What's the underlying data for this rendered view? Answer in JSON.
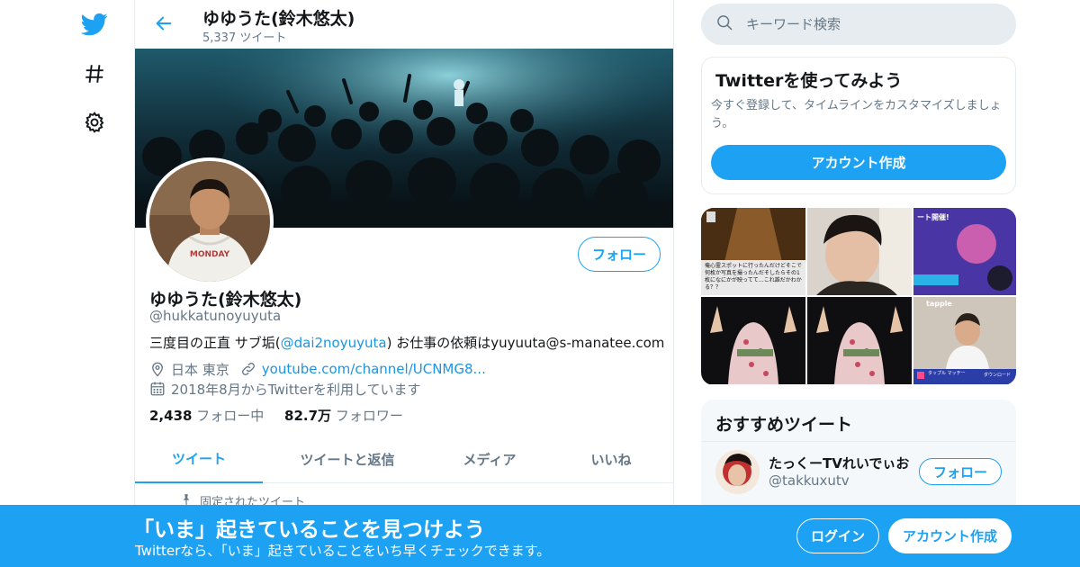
{
  "nav": {
    "icons": [
      "twitter-logo-icon",
      "hashtag-icon",
      "gear-icon"
    ]
  },
  "header": {
    "name": "ゆゆうた(鈴木悠太)",
    "tweet_count": "5,337 ツイート"
  },
  "profile": {
    "name": "ゆゆうた(鈴木悠太)",
    "handle": "@hukkatunoyuyuta",
    "bio_prefix": "三度目の正直 サブ垢(",
    "bio_link": "@dai2noyuyuta",
    "bio_suffix": ") お仕事の依頼はyuyuuta@s-manatee.com",
    "location": "日本 東京",
    "website": "youtube.com/channel/UCNMG8...",
    "joined": "2018年8月からTwitterを利用しています",
    "following_count": "2,438",
    "following_label": "フォロー中",
    "followers_count": "82.7万",
    "followers_label": "フォロワー",
    "follow_label": "フォロー",
    "avatar_shirt_text": "MONDAY"
  },
  "tabs": [
    {
      "label": "ツイート",
      "active": true
    },
    {
      "label": "ツイートと返信",
      "active": false
    },
    {
      "label": "メディア",
      "active": false
    },
    {
      "label": "いいね",
      "active": false
    }
  ],
  "pinned_label": "固定されたツイート",
  "search": {
    "placeholder": "キーワード検索"
  },
  "signup_card": {
    "title": "Twitterを使ってみよう",
    "description": "今すぐ登録して、タイムラインをカスタマイズしましょう。",
    "button": "アカウント作成"
  },
  "media_thumbs": [
    {
      "caption": "俺心霊スポットに行ったんだけどそこで何枚か写真を撮ったんだそしたらその1枚になにかが映ってて…これ誰だかわかる？？"
    },
    {
      "caption": ""
    },
    {
      "caption": "ート開催!"
    },
    {
      "caption": ""
    },
    {
      "caption": ""
    },
    {
      "caption": "tapple",
      "sub1": "タップル マッチー",
      "sub2": "ダウンロード"
    }
  ],
  "recommend": {
    "title": "おすすめツイート",
    "name": "たっくーTVれいでぃお",
    "handle": "@takkuxutv",
    "follow_label": "フォロー"
  },
  "bottom_bar": {
    "title": "「いま」起きていることを見つけよう",
    "subtitle": "Twitterなら、「いま」起きていることをいち早くチェックできます。",
    "login": "ログイン",
    "signup": "アカウント作成"
  },
  "colors": {
    "accent": "#1da1f2",
    "link": "#1b95e0",
    "muted": "#657786"
  }
}
